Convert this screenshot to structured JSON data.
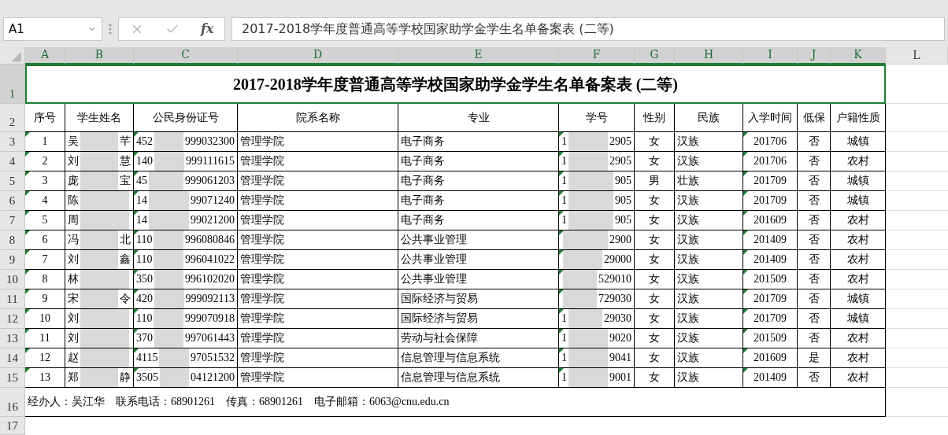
{
  "name_box": "A1",
  "formula_bar": {
    "function_label": "fx",
    "value": "2017-2018学年度普通高等学校国家助学金学生名单备案表 (二等)"
  },
  "columns": [
    {
      "label": "A",
      "selected": true
    },
    {
      "label": "B",
      "selected": true
    },
    {
      "label": "C",
      "selected": true
    },
    {
      "label": "D",
      "selected": true
    },
    {
      "label": "E",
      "selected": true
    },
    {
      "label": "F",
      "selected": true
    },
    {
      "label": "G",
      "selected": true
    },
    {
      "label": "H",
      "selected": true
    },
    {
      "label": "I",
      "selected": true
    },
    {
      "label": "J",
      "selected": true
    },
    {
      "label": "K",
      "selected": true
    },
    {
      "label": "L",
      "selected": false
    }
  ],
  "title_row": {
    "number": "1",
    "selected": true,
    "text": "2017-2018学年度普通高等学校国家助学金学生名单备案表 (二等)"
  },
  "header_row": {
    "number": "2",
    "cells": [
      "序号",
      "学生姓名",
      "公民身份证号",
      "院系名称",
      "专业",
      "学号",
      "性别",
      "民族",
      "入学时间",
      "低保",
      "户籍性质"
    ]
  },
  "data_rows": [
    {
      "number": "3",
      "flagged": true,
      "seq": "1",
      "name": {
        "start": "吴",
        "end": "芊"
      },
      "id": {
        "start": "452",
        "end": "999032300"
      },
      "dept": "管理学院",
      "major": "电子商务",
      "student_no": {
        "start": "1",
        "end": "2905"
      },
      "sex": "女",
      "ethnicity": "汉族",
      "enrolled": "201706",
      "low_income": "否",
      "household": "城镇"
    },
    {
      "number": "4",
      "flagged": true,
      "seq": "2",
      "name": {
        "start": "刘",
        "end": "慧"
      },
      "id": {
        "start": "140",
        "end": "999111615"
      },
      "dept": "管理学院",
      "major": "电子商务",
      "student_no": {
        "start": "1",
        "end": "2905"
      },
      "sex": "女",
      "ethnicity": "汉族",
      "enrolled": "201706",
      "low_income": "否",
      "household": "农村"
    },
    {
      "number": "5",
      "flagged": true,
      "seq": "3",
      "name": {
        "start": "庞",
        "end": "宝"
      },
      "id": {
        "start": "45",
        "end": "999061203"
      },
      "dept": "管理学院",
      "major": "电子商务",
      "student_no": {
        "start": "1",
        "end": "905"
      },
      "sex": "男",
      "ethnicity": "壮族",
      "enrolled": "201709",
      "low_income": "否",
      "household": "城镇"
    },
    {
      "number": "6",
      "flagged": true,
      "seq": "4",
      "name": {
        "start": "陈"
      },
      "id": {
        "start": "14",
        "end": "99071240"
      },
      "dept": "管理学院",
      "major": "电子商务",
      "student_no": {
        "start": "1",
        "end": "905"
      },
      "sex": "女",
      "ethnicity": "汉族",
      "enrolled": "201709",
      "low_income": "否",
      "household": "城镇"
    },
    {
      "number": "7",
      "flagged": true,
      "seq": "5",
      "name": {
        "start": "周"
      },
      "id": {
        "start": "14",
        "end": "99021200"
      },
      "dept": "管理学院",
      "major": "电子商务",
      "student_no": {
        "start": "1",
        "end": "905"
      },
      "sex": "女",
      "ethnicity": "汉族",
      "enrolled": "201609",
      "low_income": "否",
      "household": "农村"
    },
    {
      "number": "8",
      "flagged": true,
      "seq": "6",
      "name": {
        "start": "冯",
        "end": "北"
      },
      "id": {
        "start": "110",
        "end": "996080846"
      },
      "dept": "管理学院",
      "major": "公共事业管理",
      "student_no": {
        "end": "2900"
      },
      "sex": "女",
      "ethnicity": "汉族",
      "enrolled": "201409",
      "low_income": "否",
      "household": "农村"
    },
    {
      "number": "9",
      "flagged": true,
      "seq": "7",
      "name": {
        "start": "刘",
        "end": "鑫"
      },
      "id": {
        "start": "110",
        "end": "996041022"
      },
      "dept": "管理学院",
      "major": "公共事业管理",
      "student_no": {
        "end": "29000"
      },
      "sex": "女",
      "ethnicity": "汉族",
      "enrolled": "201409",
      "low_income": "否",
      "household": "农村"
    },
    {
      "number": "10",
      "flagged": true,
      "seq": "8",
      "name": {
        "start": "林"
      },
      "id": {
        "start": "350",
        "end": "996102020"
      },
      "dept": "管理学院",
      "major": "公共事业管理",
      "student_no": {
        "end": "529010"
      },
      "sex": "女",
      "ethnicity": "汉族",
      "enrolled": "201509",
      "low_income": "否",
      "household": "农村"
    },
    {
      "number": "11",
      "flagged": true,
      "seq": "9",
      "name": {
        "start": "宋",
        "end": "令"
      },
      "id": {
        "start": "420",
        "end": "999092113"
      },
      "dept": "管理学院",
      "major": "国际经济与贸易",
      "student_no": {
        "end": "729030"
      },
      "sex": "女",
      "ethnicity": "汉族",
      "enrolled": "201709",
      "low_income": "否",
      "household": "城镇"
    },
    {
      "number": "12",
      "flagged": true,
      "seq": "10",
      "name": {
        "start": "刘"
      },
      "id": {
        "start": "110",
        "end": "999070918"
      },
      "dept": "管理学院",
      "major": "国际经济与贸易",
      "student_no": {
        "start": "1",
        "end": "29030"
      },
      "sex": "女",
      "ethnicity": "汉族",
      "enrolled": "201709",
      "low_income": "否",
      "household": "城镇"
    },
    {
      "number": "13",
      "flagged": true,
      "seq": "11",
      "name": {
        "start": "刘"
      },
      "id": {
        "start": "370",
        "end": "997061443"
      },
      "dept": "管理学院",
      "major": "劳动与社会保障",
      "student_no": {
        "start": "1",
        "end": "9020"
      },
      "sex": "女",
      "ethnicity": "汉族",
      "enrolled": "201509",
      "low_income": "否",
      "household": "农村"
    },
    {
      "number": "14",
      "flagged": true,
      "seq": "12",
      "name": {
        "start": "赵"
      },
      "id": {
        "start": "4115",
        "end": "97051532"
      },
      "dept": "管理学院",
      "major": "信息管理与信息系统",
      "student_no": {
        "start": "1",
        "end": "9041"
      },
      "sex": "女",
      "ethnicity": "汉族",
      "enrolled": "201609",
      "low_income": "是",
      "household": "农村"
    },
    {
      "number": "15",
      "flagged": true,
      "seq": "13",
      "name": {
        "start": "郑",
        "end": "静"
      },
      "id": {
        "start": "3505",
        "end": "04121200"
      },
      "dept": "管理学院",
      "major": "信息管理与信息系统",
      "student_no": {
        "start": "1",
        "end": "9001"
      },
      "sex": "女",
      "ethnicity": "汉族",
      "enrolled": "201409",
      "low_income": "否",
      "household": "农村"
    }
  ],
  "footer_row": {
    "number": "16",
    "text": "经办人：吴江华    联系电话：68901261    传真：68901261    电子邮箱：6063@cnu.edu.cn"
  },
  "empty_row": {
    "number": "17"
  }
}
